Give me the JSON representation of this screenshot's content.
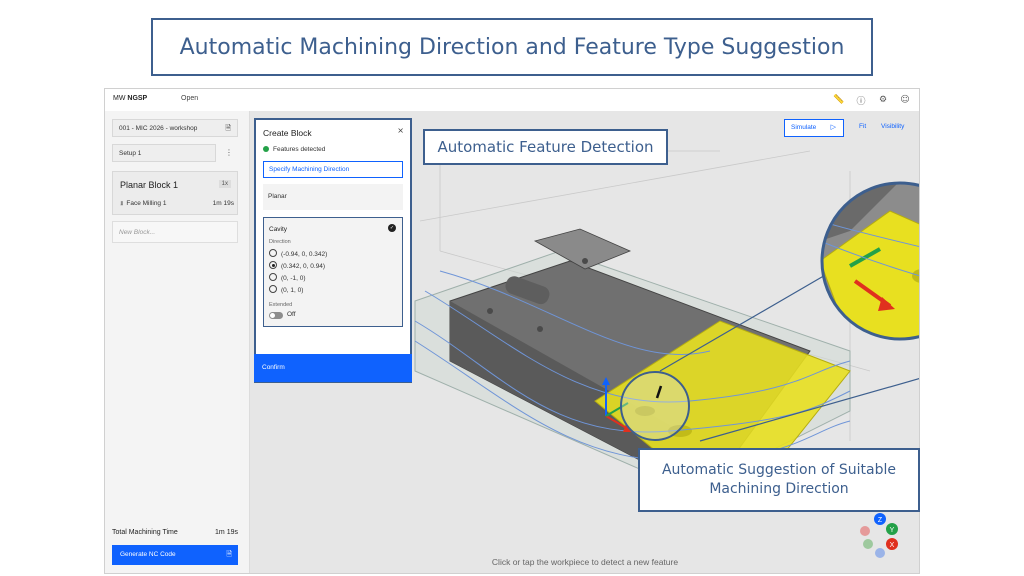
{
  "banner": {
    "title": "Automatic Machining Direction and Feature Type Suggestion"
  },
  "topbar": {
    "brand_prefix": "MW ",
    "brand_name": "NGSP",
    "open_label": "Open",
    "icons": [
      "ruler-icon",
      "info-icon",
      "gear-icon",
      "user-icon"
    ]
  },
  "sidebar": {
    "file": "001 - MIC 2026 - workshop",
    "setup": "Setup 1",
    "block": {
      "name": "Planar Block 1",
      "badge": "1x",
      "operation": "Face Milling 1",
      "time": "1m 19s"
    },
    "new_block_placeholder": "New Block...",
    "total_label": "Total Machining Time",
    "total_value": "1m 19s",
    "generate_label": "Generate NC Code"
  },
  "viewport": {
    "simulate_label": "Simulate",
    "fit_label": "Fit",
    "visibility_label": "Visibility",
    "hint": "Click or tap the workpiece to detect a new feature",
    "gizmo_labels": {
      "z": "Z",
      "y": "Y",
      "x": "X"
    },
    "colors": {
      "highlight": "#e8e020",
      "accent": "#0f62fe",
      "annotation": "#3d5f8e"
    }
  },
  "panel": {
    "title": "Create Block",
    "close": "×",
    "status": "Features detected",
    "specify_label": "Specify Machining Direction",
    "planar_label": "Planar",
    "cavity": {
      "title": "Cavity",
      "direction_label": "Direction",
      "options": [
        "(-0.94, 0, 0.342)",
        "(0.342, 0, 0.94)",
        "(0, -1, 0)",
        "(0, 1, 0)"
      ],
      "selected_index": 1,
      "extended_label": "Extended",
      "extended_value": "Off"
    },
    "confirm_label": "Confirm"
  },
  "callouts": {
    "feature_detection": "Automatic Feature Detection",
    "direction_suggestion_line1": "Automatic Suggestion of Suitable",
    "direction_suggestion_line2": "Machining Direction"
  }
}
